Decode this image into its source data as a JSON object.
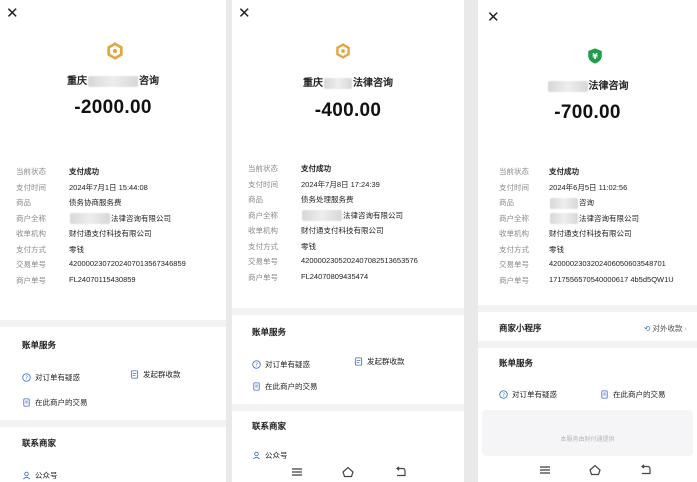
{
  "panels": [
    {
      "merchant_visible": "重庆",
      "merchant_suffix": "咨询",
      "amount": "-2000.00",
      "details": [
        {
          "label": "当前状态",
          "value": "支付成功"
        },
        {
          "label": "支付时间",
          "value": "2024年7月1日 15:44:08"
        },
        {
          "label": "商品",
          "value": "债务协商服务费"
        },
        {
          "label": "商户全称",
          "value": "法律咨询有限公司"
        },
        {
          "label": "收单机构",
          "value": "财付通支付科技有限公司"
        },
        {
          "label": "支付方式",
          "value": "零钱"
        },
        {
          "label": "交易单号",
          "value": "4200002307202407013567346859"
        },
        {
          "label": "商户单号",
          "value": "FL24070115430859"
        }
      ],
      "billing_section": "账单服务",
      "actions": {
        "query": "对订单有疑惑",
        "group": "发起群收款",
        "merchant_txn": "在此商户的交易"
      },
      "contact_section": "联系商家",
      "official_account": "公众号"
    },
    {
      "merchant_visible": "重庆",
      "merchant_suffix": "法律咨询",
      "amount": "-400.00",
      "details": [
        {
          "label": "当前状态",
          "value": "支付成功"
        },
        {
          "label": "支付时间",
          "value": "2024年7月8日 17:24:39"
        },
        {
          "label": "商品",
          "value": "债务处理服务费"
        },
        {
          "label": "商户全称",
          "value": "法律咨询有限公司"
        },
        {
          "label": "收单机构",
          "value": "财付通支付科技有限公司"
        },
        {
          "label": "支付方式",
          "value": "零钱"
        },
        {
          "label": "交易单号",
          "value": "4200002305202407082513653576"
        },
        {
          "label": "商户单号",
          "value": "FL24070809435474"
        }
      ],
      "billing_section": "账单服务",
      "actions": {
        "query": "对订单有疑惑",
        "group": "发起群收款",
        "merchant_txn": "在此商户的交易"
      },
      "contact_section": "联系商家",
      "official_account": "公众号"
    },
    {
      "merchant_suffix": "法律咨询",
      "amount": "-700.00",
      "details": [
        {
          "label": "当前状态",
          "value": "支付成功"
        },
        {
          "label": "支付时间",
          "value": "2024年6月5日 11:02:56"
        },
        {
          "label": "商品",
          "value": "咨询"
        },
        {
          "label": "商户全称",
          "value": "法律咨询有限公司"
        },
        {
          "label": "收单机构",
          "value": "财付通支付科技有限公司"
        },
        {
          "label": "支付方式",
          "value": "零钱"
        },
        {
          "label": "交易单号",
          "value": "4200002303202406050603548701"
        },
        {
          "label": "商户单号",
          "value": "1717556570540000617 4b5d5QW1U"
        }
      ],
      "mini_program": "商家小程序",
      "external_payment": "对外收款",
      "billing_section": "账单服务",
      "actions": {
        "query": "对订单有疑惑",
        "merchant_txn": "在此商户的交易"
      },
      "footer_note": "本服务由财付通提供"
    }
  ],
  "icons": {
    "close": "close-icon",
    "logo_orange": "merchant-logo-icon",
    "logo_green": "wechat-pay-shield-icon",
    "help": "question-circle-icon",
    "group": "group-collect-icon",
    "doc": "transaction-doc-icon",
    "person": "official-account-icon",
    "menu": "menu-icon",
    "home": "home-icon",
    "back": "back-icon"
  },
  "colors": {
    "link_blue": "#3a68c9",
    "logo_orange": "#e0a840",
    "logo_green": "#1f9d4a",
    "divider": "#f2f2f2"
  }
}
